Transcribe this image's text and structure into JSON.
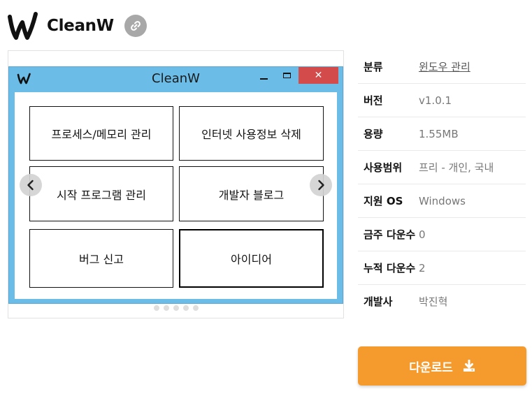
{
  "app": {
    "name": "CleanW",
    "logo_icon": "w-logo-icon",
    "link_icon": "link-icon"
  },
  "screenshot": {
    "window_title": "CleanW",
    "close_glyph": "✕",
    "buttons": [
      "프로세스/메모리 관리",
      "인터넷 사용정보 삭제",
      "시작 프로그램 관리",
      "개발자 블로그",
      "버그 신고",
      "아이디어"
    ],
    "dot_count": 5
  },
  "info": [
    {
      "label": "분류",
      "value": "윈도우 관리",
      "link": true
    },
    {
      "label": "버전",
      "value": "v1.0.1"
    },
    {
      "label": "용량",
      "value": "1.55MB"
    },
    {
      "label": "사용범위",
      "value": "프리 - 개인, 국내"
    },
    {
      "label": "지원 OS",
      "value": "Windows"
    },
    {
      "label": "금주 다운수",
      "value": "0"
    },
    {
      "label": "누적 다운수",
      "value": "2"
    },
    {
      "label": "개발사",
      "value": "박진혁"
    }
  ],
  "download": {
    "label": "다운로드",
    "icon": "download-icon"
  },
  "colors": {
    "accent": "#f59a2c",
    "window_frame": "#6bbde8",
    "close_button": "#d34b4b"
  }
}
